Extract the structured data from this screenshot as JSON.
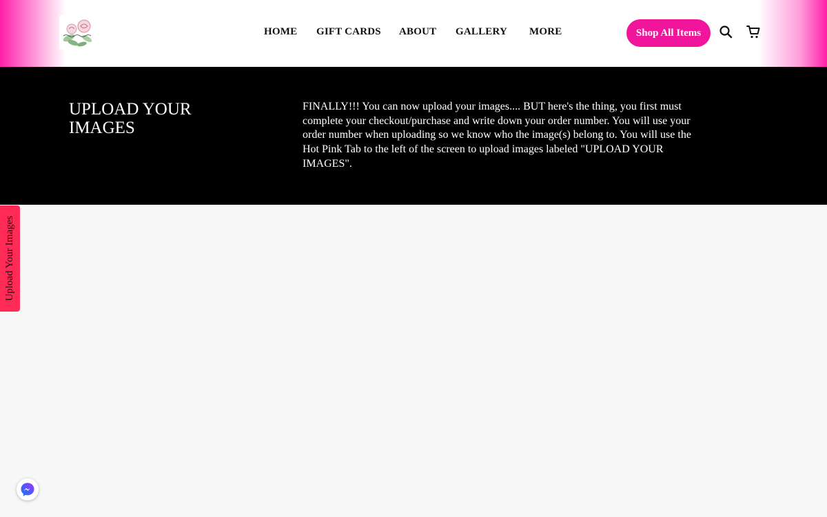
{
  "header": {
    "logo_alt": "logo",
    "nav": [
      {
        "label": "HOME"
      },
      {
        "label": "GIFT CARDS"
      },
      {
        "label": "ABOUT"
      },
      {
        "label": "GALLERY"
      },
      {
        "label": "MORE"
      }
    ],
    "shop_button_label": "Shop All Items",
    "icons": {
      "search": "search-icon",
      "cart": "cart-icon"
    }
  },
  "hero": {
    "title": "UPLOAD YOUR IMAGES",
    "body": "FINALLY!!! You can now upload your images.... BUT here's the thing, you first must complete your checkout/purchase and write down your order number. You will use your order number when uploading so we know who the image(s) belong to. You will use the Hot Pink Tab to the left of the screen to upload images labeled \"UPLOAD YOUR IMAGES\"."
  },
  "side_tab": {
    "label": "Upload Your Images"
  },
  "chat": {
    "icon": "messenger-icon"
  },
  "colors": {
    "accent_pink": "#f0159b",
    "tab_red": "#ff2a55",
    "hero_bg": "#000000",
    "page_bg": "#f7f7f7"
  }
}
